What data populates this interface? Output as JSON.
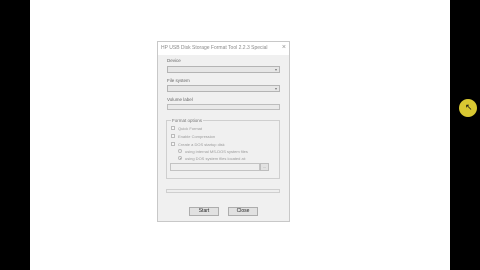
{
  "window": {
    "title": "HP USB Disk Storage Format Tool 2.2.3 Special",
    "close_glyph": "×"
  },
  "device": {
    "label": "Device",
    "value": ""
  },
  "file_system": {
    "label": "File system",
    "value": ""
  },
  "volume_label": {
    "label": "Volume label",
    "value": ""
  },
  "format_options": {
    "title": "Format options",
    "quick_format": {
      "label": "Quick Format",
      "checked": false
    },
    "enable_compression": {
      "label": "Enable Compression",
      "checked": false
    },
    "create_dos_disk": {
      "label": "Create a DOS startup disk",
      "checked": false
    },
    "radio_internal": {
      "label": "using internal MS-DOS system files",
      "selected": false
    },
    "radio_located": {
      "label": "using DOS system files located at:",
      "selected": true
    },
    "dos_path": {
      "value": ""
    },
    "browse_label": "..."
  },
  "buttons": {
    "start": "Start",
    "close": "Close"
  },
  "icons": {
    "close": "close-icon",
    "dropdown": "chevron-down-icon",
    "cursor": "mouse-pointer-icon"
  },
  "colors": {
    "cursor_highlight": "#ffeb3b"
  }
}
